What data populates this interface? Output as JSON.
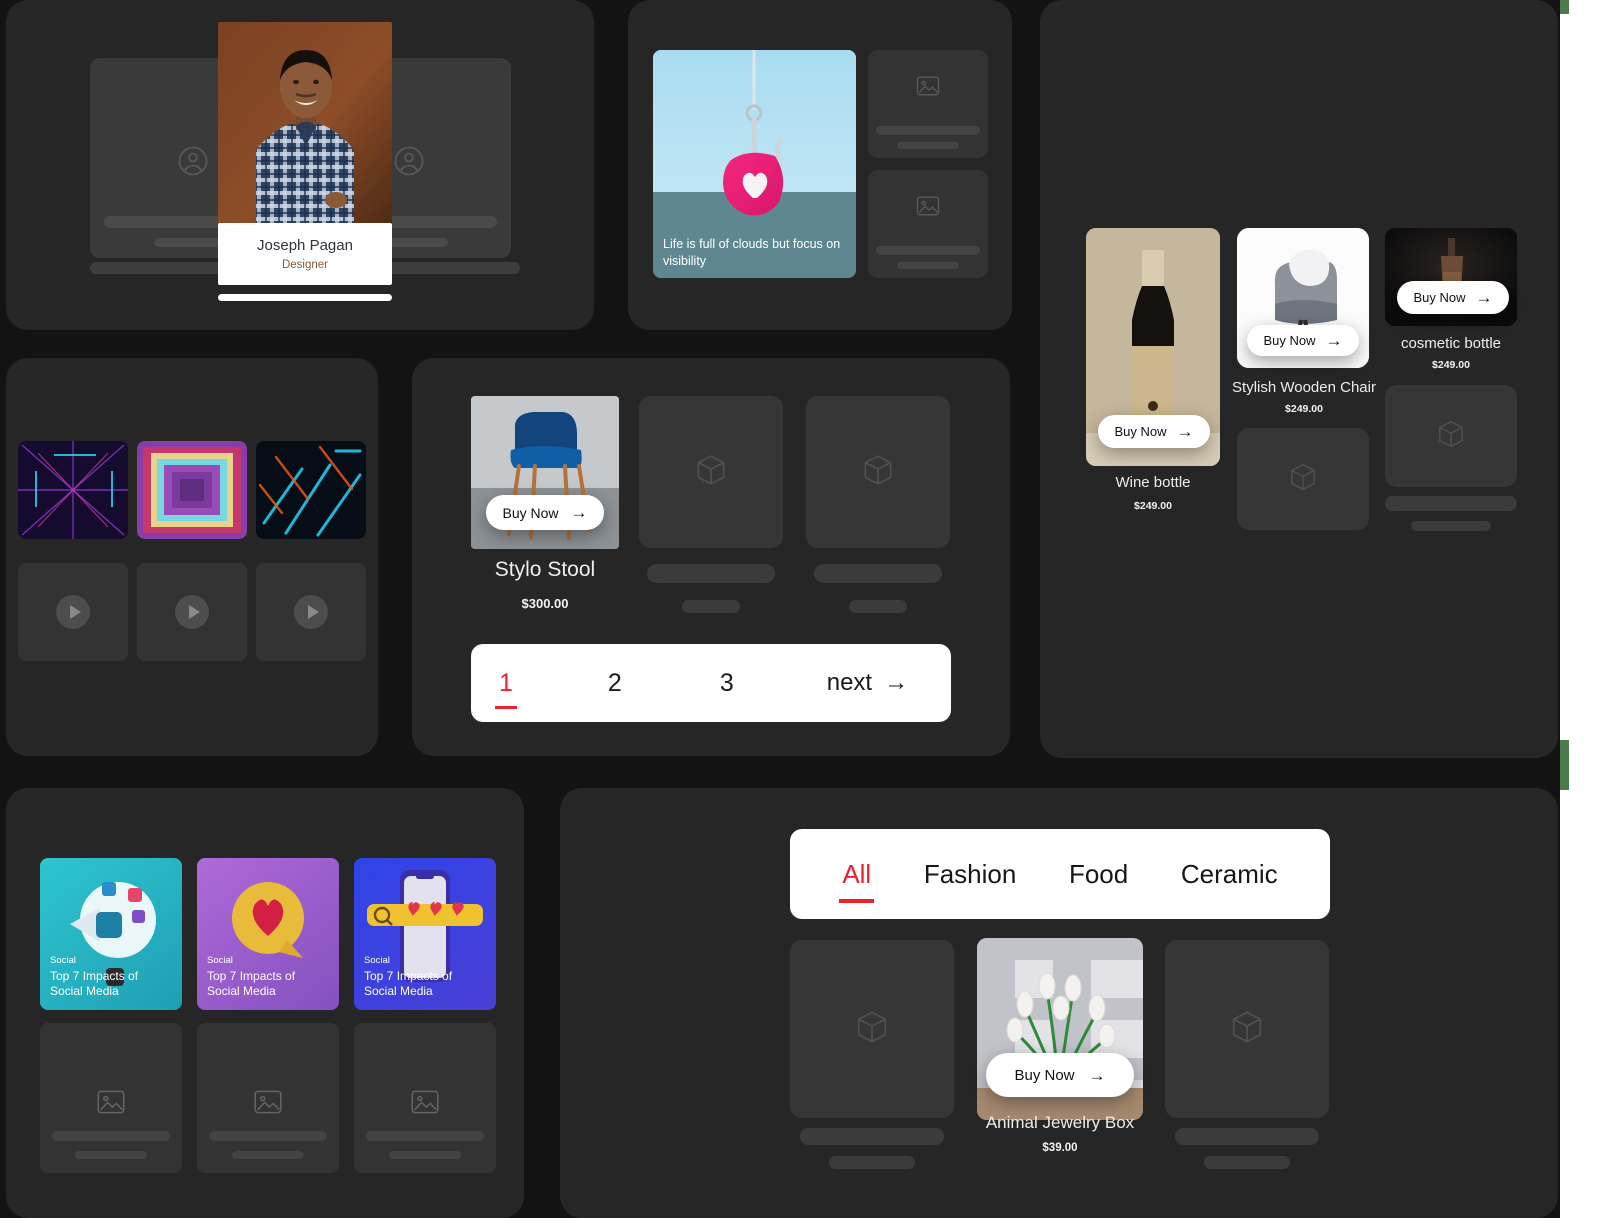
{
  "theme": {
    "bg": "#131313",
    "panel": "#262626",
    "accent_red": "#e8232f",
    "white": "#ffffff",
    "rail_green": "#4b7a4b"
  },
  "team_panel": {
    "name": "Joseph Pagan",
    "role": "Designer",
    "placeholder_avatar_icon": "user-circle-icon"
  },
  "quote_panel": {
    "caption": "Life is full of clouds but focus on visibility",
    "placeholder_image_icon": "image-icon"
  },
  "videos_panel": {
    "play_icon": "play-icon"
  },
  "shop_center": {
    "product": {
      "title": "Stylo Stool",
      "price": "$300.00",
      "buy_label": "Buy Now",
      "arrow": "→"
    },
    "placeholder_icon": "package-icon",
    "pagination": {
      "pages": [
        "1",
        "2",
        "3"
      ],
      "active": "1",
      "next_label": "next",
      "next_arrow": "→"
    }
  },
  "shop_right": {
    "buy_label": "Buy Now",
    "arrow": "→",
    "products": [
      {
        "title": "Wine bottle",
        "price": "$249.00",
        "buy_label": "Buy Now"
      },
      {
        "title": "Stylish Wooden Chair",
        "price": "$249.00",
        "buy_label": "Buy Now"
      },
      {
        "title": "cosmetic bottle",
        "price": "$249.00",
        "buy_label": "Buy Now"
      }
    ],
    "placeholder_icon": "package-icon"
  },
  "social_panel": {
    "cards": [
      {
        "tag": "Social",
        "title": "Top 7 Impacts of Social Media"
      },
      {
        "tag": "Social",
        "title": "Top 7 Impacts of Social Media"
      },
      {
        "tag": "Social",
        "title": "Top 7 Impacts of Social Media"
      }
    ],
    "placeholder_icon": "image-icon"
  },
  "tab_shop": {
    "tabs": [
      {
        "label": "All",
        "active": true
      },
      {
        "label": "Fashion",
        "active": false
      },
      {
        "label": "Food",
        "active": false
      },
      {
        "label": "Ceramic",
        "active": false
      }
    ],
    "product": {
      "title": "Animal Jewelry Box",
      "price": "$39.00",
      "buy_label": "Buy Now",
      "arrow": "→"
    },
    "placeholder_icon": "package-icon"
  }
}
